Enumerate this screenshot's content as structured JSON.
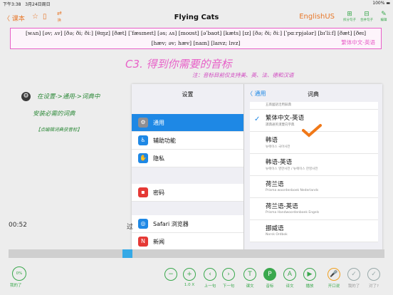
{
  "status": {
    "time": "下午3:38",
    "date": "3月24日周日",
    "battery": "100% ▬"
  },
  "nav": {
    "back": "〈 课本",
    "title": "Flying Cats",
    "lang": "EnglishUS",
    "icon1_label": "换",
    "right_buttons": [
      {
        "glyph": "⊞",
        "label": "拆分句子"
      },
      {
        "glyph": "⊟",
        "label": "合并句子"
      },
      {
        "glyph": "✎",
        "label": "编辑"
      }
    ]
  },
  "sentence": {
    "line1": "[wʌn] [əv; ʌv] [ðə; ði; ðiː] [θɪŋz] [ðæt] [ˈfæsɪneɪt] [əs; ʌs] [moʊst] [əˈbaʊt] [kæts] [ɪz] [ðə; ði; ðiː] [ˈpɑːrpjələr] [bɪˈliːf] [ðæt] [ðeɪ]",
    "line2": "[hæv; əv; hæv] [naɪn] [laɪvz; lɪvz]",
    "dict_tag": "繁体中文-英语"
  },
  "heading": "C3. 得到你需要的音标",
  "note": "注：音标目前仅支持美、英、法、德和汉语",
  "side": {
    "gear": "⚙",
    "line1": "在设置->通用->词典中",
    "line2": "安装必需的词典",
    "line3": "【点编辑词典获音标】"
  },
  "settings": {
    "title": "设置",
    "rows": [
      {
        "label": "通用",
        "color": "#8e8e93",
        "glyph": "⚙",
        "selected": true
      },
      {
        "label": "辅助功能",
        "color": "#1e88e5",
        "glyph": "♿",
        "selected": false
      },
      {
        "label": "隐私",
        "color": "#1e88e5",
        "glyph": "✋",
        "selected": false
      },
      {
        "label": "密码",
        "color": "#e53935",
        "glyph": "▪",
        "selected": false
      },
      {
        "label": "Safari 浏览器",
        "color": "#1e88e5",
        "glyph": "◎",
        "selected": false
      },
      {
        "label": "新闻",
        "color": "#e53935",
        "glyph": "N",
        "selected": false
      }
    ]
  },
  "dict": {
    "back": "〈 通用",
    "title": "词典",
    "top_small": "五南國語活用辭典",
    "items": [
      {
        "name": "繁体中文-英语",
        "sub": "譯典通英漢雙向字典",
        "checked": true
      },
      {
        "name": "韩语",
        "sub": "뉴에이스 국어사전",
        "checked": false
      },
      {
        "name": "韩语-英语",
        "sub": "뉴에이스 영한사전 / 뉴에이스 한영사전",
        "checked": false
      },
      {
        "name": "荷兰语",
        "sub": "Prisma woordenboek Nederlands",
        "checked": false
      },
      {
        "name": "荷兰语-英语",
        "sub": "Prisma Handwoordenboek Engels",
        "checked": false
      },
      {
        "name": "挪威语",
        "sub": "Norsk Ordbok",
        "checked": false
      }
    ]
  },
  "player": {
    "time": "00:52",
    "marker": "过"
  },
  "progress": {
    "pct": "0%",
    "label": "我的了"
  },
  "controls": [
    {
      "glyph": "−",
      "label": "",
      "style": ""
    },
    {
      "glyph": "+",
      "label": "1.0 X",
      "style": ""
    },
    {
      "glyph": "‹",
      "label": "上一句",
      "style": ""
    },
    {
      "glyph": "›",
      "label": "下一句",
      "style": ""
    },
    {
      "glyph": "T",
      "label": "课文",
      "style": ""
    },
    {
      "glyph": "P",
      "label": "音标",
      "style": "f"
    },
    {
      "glyph": "A",
      "label": "译文",
      "style": ""
    },
    {
      "glyph": "▶",
      "label": "播放",
      "style": ""
    },
    {
      "glyph": "🎤",
      "label": "开口说",
      "style": "or"
    },
    {
      "glyph": "✓",
      "label": "我的了",
      "style": "gr"
    },
    {
      "glyph": "✓",
      "label": "对了?",
      "style": "gr"
    }
  ],
  "colors": {
    "accent": "#e8782a",
    "green": "#3aa84d",
    "pink": "#e860c8",
    "blue": "#1e88e5"
  }
}
